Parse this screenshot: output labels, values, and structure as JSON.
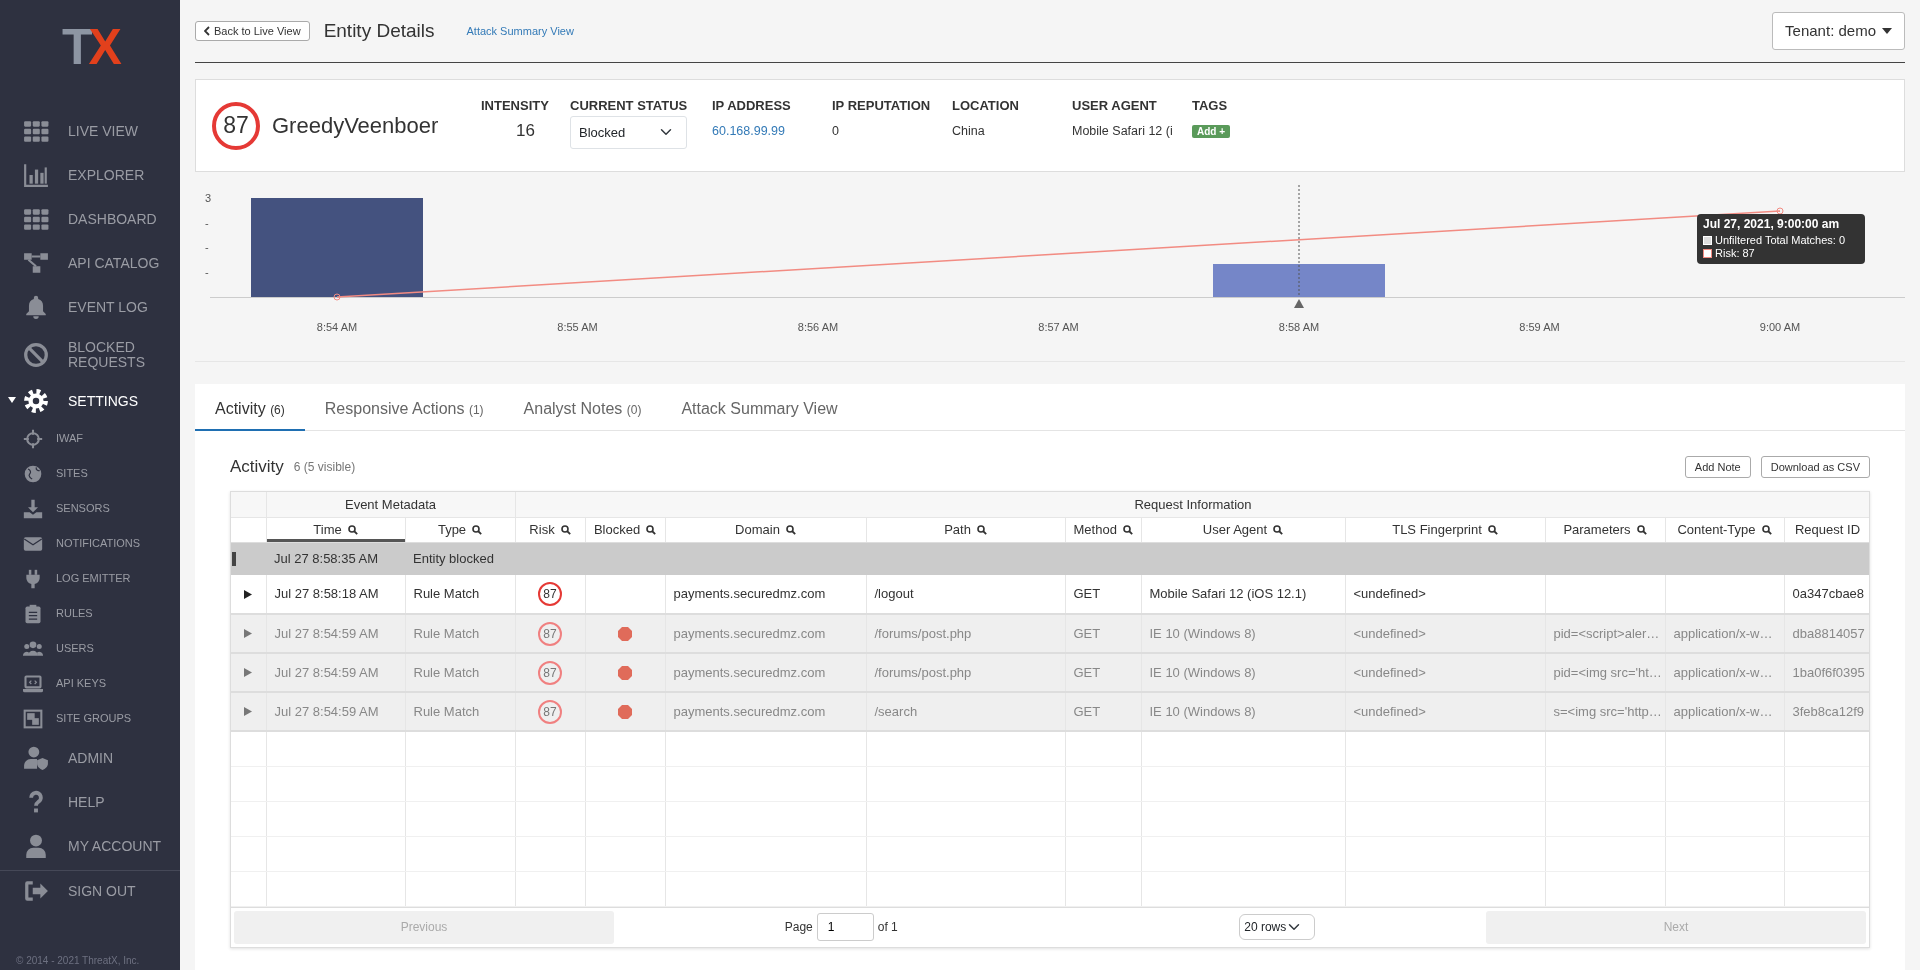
{
  "sidebar": {
    "logo": [
      "T",
      "X"
    ],
    "items": [
      {
        "label": "LIVE VIEW",
        "selected": false
      },
      {
        "label": "EXPLORER",
        "selected": false
      },
      {
        "label": "DASHBOARD",
        "selected": false
      },
      {
        "label": "API CATALOG",
        "selected": false
      },
      {
        "label": "EVENT LOG",
        "selected": false
      },
      {
        "label": "BLOCKED REQUESTS",
        "selected": false
      },
      {
        "label": "SETTINGS",
        "selected": true,
        "expanded": true,
        "children": [
          {
            "label": "IWAF"
          },
          {
            "label": "SITES"
          },
          {
            "label": "SENSORS"
          },
          {
            "label": "NOTIFICATIONS"
          },
          {
            "label": "LOG EMITTER"
          },
          {
            "label": "RULES"
          },
          {
            "label": "USERS"
          },
          {
            "label": "API KEYS"
          },
          {
            "label": "SITE GROUPS"
          }
        ]
      },
      {
        "label": "ADMIN",
        "selected": false
      },
      {
        "label": "HELP",
        "selected": false
      },
      {
        "label": "MY ACCOUNT",
        "selected": false
      }
    ],
    "sign_out": "SIGN OUT",
    "copyright": "© 2014 - 2021 ThreatX, Inc."
  },
  "header": {
    "back_button": "Back to Live View",
    "title": "Entity Details",
    "link": "Attack Summary View",
    "tenant": "Tenant: demo"
  },
  "entity": {
    "risk": "87",
    "name": "GreedyVeenboer",
    "fields": [
      {
        "label": "INTENSITY",
        "value": "16",
        "kind": "number"
      },
      {
        "label": "CURRENT STATUS",
        "value": "Blocked",
        "kind": "select"
      },
      {
        "label": "IP ADDRESS",
        "value": "60.168.99.99",
        "kind": "link"
      },
      {
        "label": "IP REPUTATION",
        "value": "0",
        "kind": "text"
      },
      {
        "label": "LOCATION",
        "value": "China",
        "kind": "text"
      },
      {
        "label": "USER AGENT",
        "value": "Mobile Safari 12 (i",
        "kind": "text"
      },
      {
        "label": "TAGS",
        "value": "Add +",
        "kind": "tag-button"
      }
    ]
  },
  "chart": {
    "x_labels": [
      "8:54 AM",
      "8:55 AM",
      "8:56 AM",
      "8:57 AM",
      "8:58 AM",
      "8:59 AM",
      "9:00 AM"
    ],
    "y_labels": [
      "3",
      "-",
      "-",
      "-"
    ],
    "tooltip": {
      "title": "Jul 27, 2021, 9:00:00 am",
      "lines": [
        "Unfiltered Total Matches: 0",
        "Risk: 87"
      ]
    }
  },
  "tabs": [
    {
      "label": "Activity",
      "count": "(6)",
      "selected": true
    },
    {
      "label": "Responsive Actions",
      "count": "(1)",
      "selected": false
    },
    {
      "label": "Analyst Notes",
      "count": "(0)",
      "selected": false
    },
    {
      "label": "Attack Summary View",
      "selected": false
    }
  ],
  "activity": {
    "title": "Activity",
    "count": "6 (5 visible)",
    "buttons": [
      "Add Note",
      "Download as CSV"
    ],
    "column_groups": [
      {
        "label": "Event Metadata",
        "columns": [
          {
            "label": "Time",
            "sorted": true,
            "search": true
          },
          {
            "label": "Type",
            "sorted": false,
            "search": true
          }
        ]
      },
      {
        "label": "Request Information",
        "columns": [
          {
            "label": "Risk",
            "sorted": false,
            "search": true
          },
          {
            "label": "Blocked",
            "sorted": false,
            "search": true
          },
          {
            "label": "Domain",
            "sorted": false,
            "search": true
          },
          {
            "label": "Path",
            "sorted": false,
            "search": true
          },
          {
            "label": "Method",
            "sorted": false,
            "search": true
          },
          {
            "label": "User Agent",
            "sorted": false,
            "search": true
          },
          {
            "label": "TLS Fingerprint",
            "sorted": false,
            "search": true
          },
          {
            "label": "Parameters",
            "sorted": false,
            "search": true
          },
          {
            "label": "Content-Type",
            "sorted": false,
            "search": true
          },
          {
            "label": "Request ID",
            "sorted": false,
            "search": false
          }
        ]
      }
    ],
    "rows": [
      {
        "kind": "event",
        "time": "Jul 27 8:58:35 AM",
        "type": "Entity blocked"
      },
      {
        "kind": "match",
        "expanded": false,
        "dimmed": false,
        "blocked": false,
        "time": "Jul 27 8:58:18 AM",
        "type": "Rule Match",
        "risk": "87",
        "domain": "payments.securedmz.com",
        "path": "/logout",
        "method": "GET",
        "user_agent": "Mobile Safari 12 (iOS 12.1)",
        "tls": "<undefined>",
        "request_id": "0a347cbae8"
      },
      {
        "kind": "match",
        "expanded": false,
        "dimmed": true,
        "blocked": true,
        "time": "Jul 27 8:54:59 AM",
        "type": "Rule Match",
        "risk": "87",
        "domain": "payments.securedmz.com",
        "path": "/forums/post.php",
        "method": "GET",
        "user_agent": "IE 10 (Windows 8)",
        "tls": "<undefined>",
        "parameters": "pid=<script>aler…",
        "content_type": "application/x-w…",
        "request_id": "dba8814057"
      },
      {
        "kind": "match",
        "expanded": false,
        "dimmed": true,
        "blocked": true,
        "time": "Jul 27 8:54:59 AM",
        "type": "Rule Match",
        "risk": "87",
        "domain": "payments.securedmz.com",
        "path": "/forums/post.php",
        "method": "GET",
        "user_agent": "IE 10 (Windows 8)",
        "tls": "<undefined>",
        "parameters": "pid=<img src='ht…",
        "content_type": "application/x-w…",
        "request_id": "1ba0f6f0395"
      },
      {
        "kind": "match",
        "expanded": false,
        "dimmed": true,
        "blocked": true,
        "time": "Jul 27 8:54:59 AM",
        "type": "Rule Match",
        "risk": "87",
        "domain": "payments.securedmz.com",
        "path": "/search",
        "method": "GET",
        "user_agent": "IE 10 (Windows 8)",
        "tls": "<undefined>",
        "parameters": "s=<img src='http…",
        "content_type": "application/x-w…",
        "request_id": "3feb8ca12f9"
      }
    ],
    "pagination": {
      "previous": "Previous",
      "previous_disabled": true,
      "page_label": "Page",
      "page": "1",
      "of": "of 1",
      "rows": "20 rows",
      "next": "Next",
      "next_disabled": true
    }
  }
}
